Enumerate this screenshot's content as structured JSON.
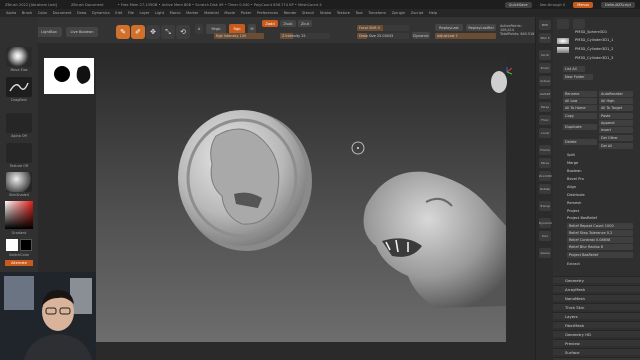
{
  "titlebar": {
    "left_text": "ZBrush 2022 [Abraham Leal]",
    "doc_text": "ZBrush Document",
    "stats": "• Free Mem 27.139GB • Active Mem 808 • Scratch Disk 49 • Timer 0.040 • PolyCount 636.774 KP • MeshCount 4",
    "quicksave": "QuickSave",
    "seethrough": "See-through",
    "seethrough_value": "0",
    "menus": "Menus",
    "default_script": "DefaultZScript"
  },
  "menubar": {
    "items": [
      "Alpha",
      "Brush",
      "Color",
      "Document",
      "Draw",
      "Dynamics",
      "Edit",
      "File",
      "Layer",
      "Light",
      "Macro",
      "Marker",
      "Material",
      "Movie",
      "Picker",
      "Preferences",
      "Render",
      "Stencil",
      "Stroke",
      "Texture",
      "Tool",
      "Transform",
      "Zplugin",
      "Zscript",
      "Help"
    ]
  },
  "toolbar": {
    "coords": "-2.196 -1.195 0.672",
    "home_page": "Home Page",
    "lightbox": "LightBox",
    "live_boolean": "Live Boolean",
    "edit": "Edit",
    "draw": "Draw",
    "move": "Move",
    "scale": "Scale",
    "rotate": "Rotate",
    "a_label": "A",
    "mrgb": "Mrgb",
    "rgb": "Rgb",
    "m_label": "M",
    "zadd": "Zadd",
    "zsub": "Zsub",
    "zcut": "Zcut",
    "rgb_intensity": "Rgb Intensity 100",
    "z_intensity": "Z Intensity 25",
    "focal_shift": "Focal Shift 0",
    "draw_size": "Draw Size 25.03433",
    "dynamic": "Dynamic",
    "replay_last": "ReplayLast",
    "replay_last_rel": "ReplayLastRel",
    "adjust_last": "AdjustLast 1",
    "active_points": "ActivePoints: 108,414",
    "total_points": "TotalPoints: 640.516"
  },
  "left_panel": {
    "brush_label": "Move Elas",
    "stroke_label": "DragRect",
    "alpha_label": "Alpha Off",
    "texture_label": "Texture Off",
    "material_label": "SkinShade4",
    "gradient_label": "Gradient",
    "switch_color": "SwitchColor",
    "alternate": "Alternate"
  },
  "right_panel": {
    "subtool_names": [
      "PM3D_Sphere3D1",
      "PM3D_Cylinder3D1_1",
      "PM3D_Cylinder3D1_2",
      "PM3D_Cylinder3D1_3"
    ],
    "list_all": "List All",
    "new_folder": "New Folder",
    "rename": "Rename",
    "auto_reorder": "AutoReorder",
    "all_low": "All Low",
    "all_high": "All High",
    "all_to_home": "All To Home",
    "all_to_target": "All To Target",
    "copy": "Copy",
    "paste": "Paste",
    "append": "Append",
    "duplicate": "Duplicate",
    "insert": "Insert",
    "delete": "Delete",
    "del_other": "Del Other",
    "del_all": "Del All",
    "split": "Split",
    "merge": "Merge",
    "boolean": "Boolean",
    "bevel_pro": "Bevel Pro",
    "align": "Align",
    "distribute": "Distribute",
    "remesh": "Remesh",
    "project": "Project",
    "project_basrelief": "Project BasRelief",
    "relief_repeat": "Relief Repeat Count 1000",
    "relief_step": "Relief Step Tolerance 0.2",
    "relief_contrast": "Relief Contrast 0.08658",
    "relief_blur": "Relief Blur Radius 6",
    "project_basrelief_btn": "Project BasRelief",
    "extract": "Extract",
    "sections": [
      "Geometry",
      "ArrayMesh",
      "NanoMesh",
      "Thick Skin",
      "Layers",
      "FiberMesh",
      "Geometry HD",
      "Preview",
      "Surface",
      "Deformation"
    ]
  },
  "right_strip": {
    "labels": [
      "BPR",
      "SPix 3",
      "",
      "Scroll",
      "Zoom",
      "Actual",
      "AAHalf",
      "Persp",
      "Floor",
      "Local",
      "",
      "Frame",
      "Move",
      "Zoom3D",
      "Rotate",
      "",
      "Transp",
      "",
      "Dynamic",
      "Solo",
      "",
      "Xpose"
    ]
  },
  "colors": {
    "accent": "#d0702a",
    "canvas_top": "#2a2a2a",
    "canvas_bottom": "#6d6d6d",
    "panel_bg": "#2f2f2f",
    "slider_fill": "#8a5a2e"
  }
}
